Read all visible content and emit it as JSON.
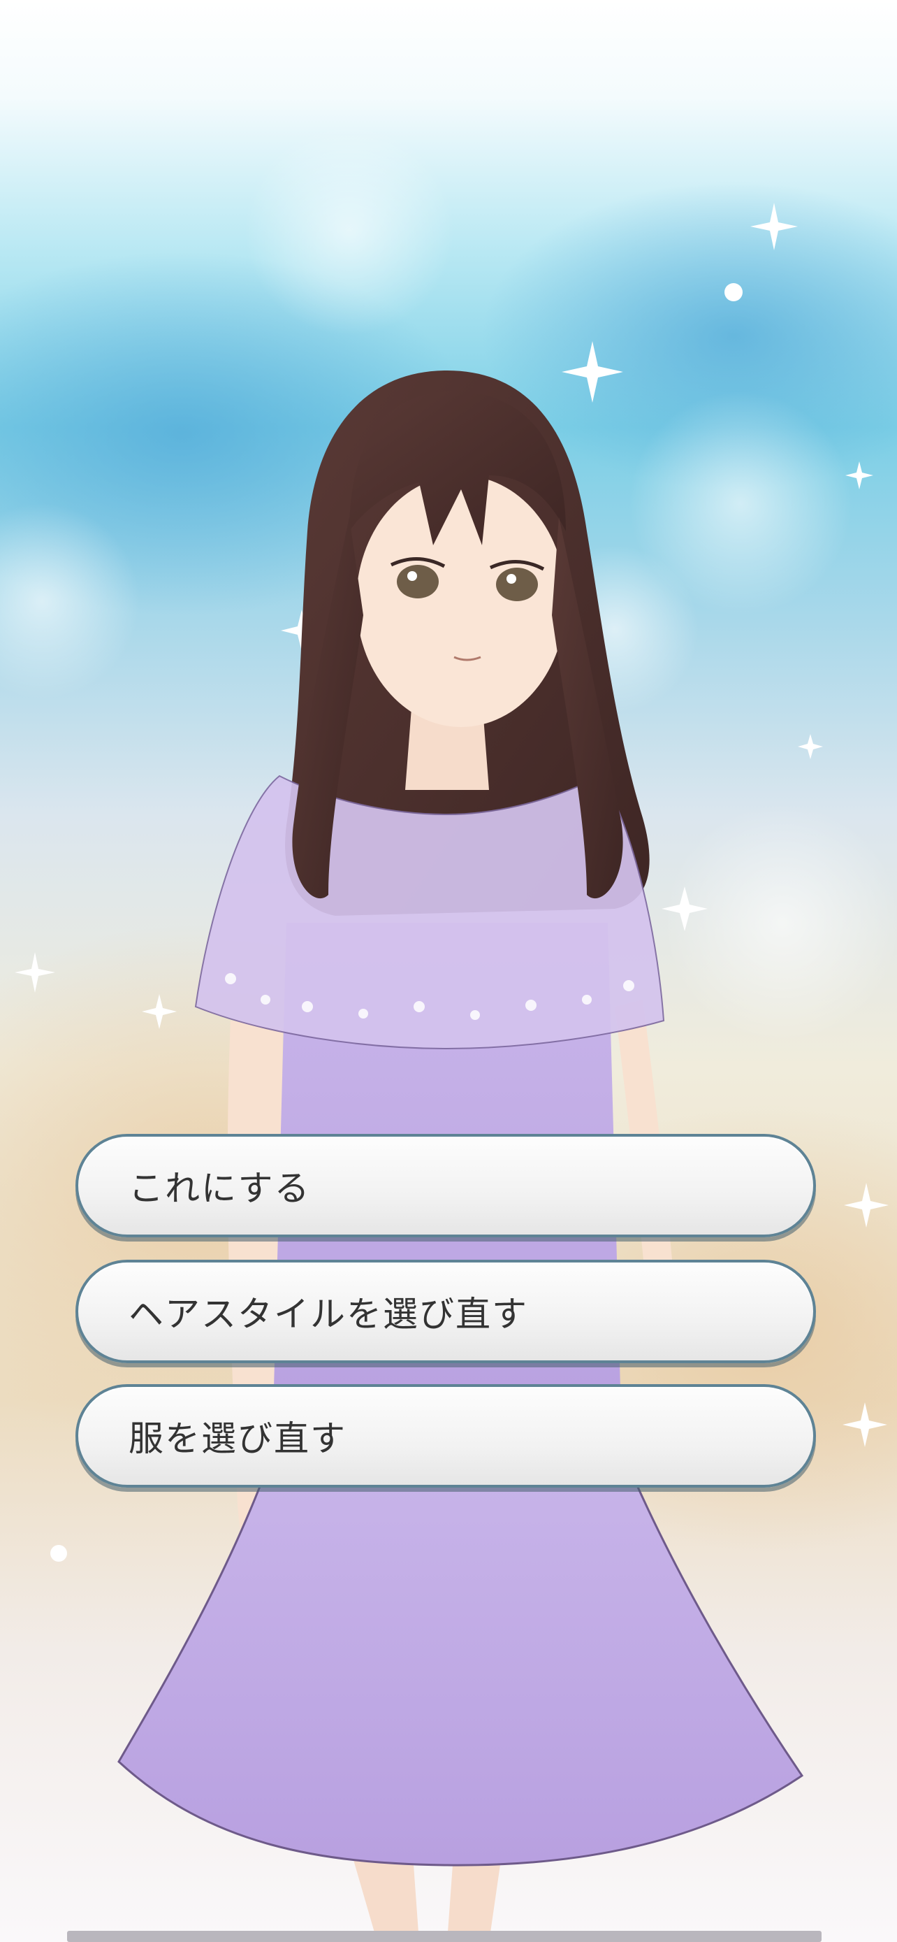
{
  "scene": {
    "character": "anime-girl-long-brown-hair-lavender-dress",
    "background": "pastel-sky-bokeh-sparkles",
    "colors": {
      "sky": "#8fd6ea",
      "hair": "#4a2f2c",
      "dress": "#c7b3e6",
      "button_border": "#5e8395",
      "button_text": "#333333"
    }
  },
  "choices": [
    {
      "label": "これにする"
    },
    {
      "label": "ヘアスタイルを選び直す"
    },
    {
      "label": "服を選び直す"
    }
  ]
}
